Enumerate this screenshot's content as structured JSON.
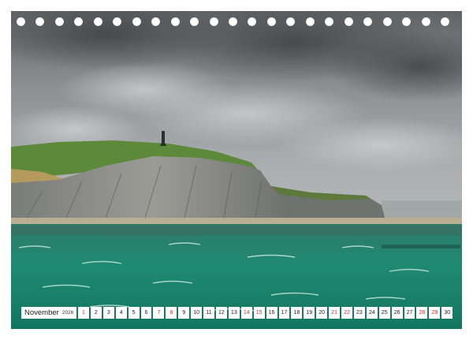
{
  "calendar": {
    "month_label": "November",
    "year_label": "2026",
    "days": [
      "1",
      "2",
      "3",
      "4",
      "5",
      "6",
      "7",
      "8",
      "9",
      "10",
      "11",
      "12",
      "13",
      "14",
      "15",
      "16",
      "17",
      "18",
      "19",
      "20",
      "21",
      "22",
      "23",
      "24",
      "25",
      "26",
      "27",
      "28",
      "29",
      "30"
    ],
    "weekend_days": [
      "1",
      "7",
      "8",
      "14",
      "15",
      "21",
      "22",
      "28",
      "29"
    ],
    "weekend_color": "#c0392b"
  },
  "binding": {
    "hole_count": 23
  },
  "photo": {
    "subject": "cliffs-with-monument-icon"
  }
}
